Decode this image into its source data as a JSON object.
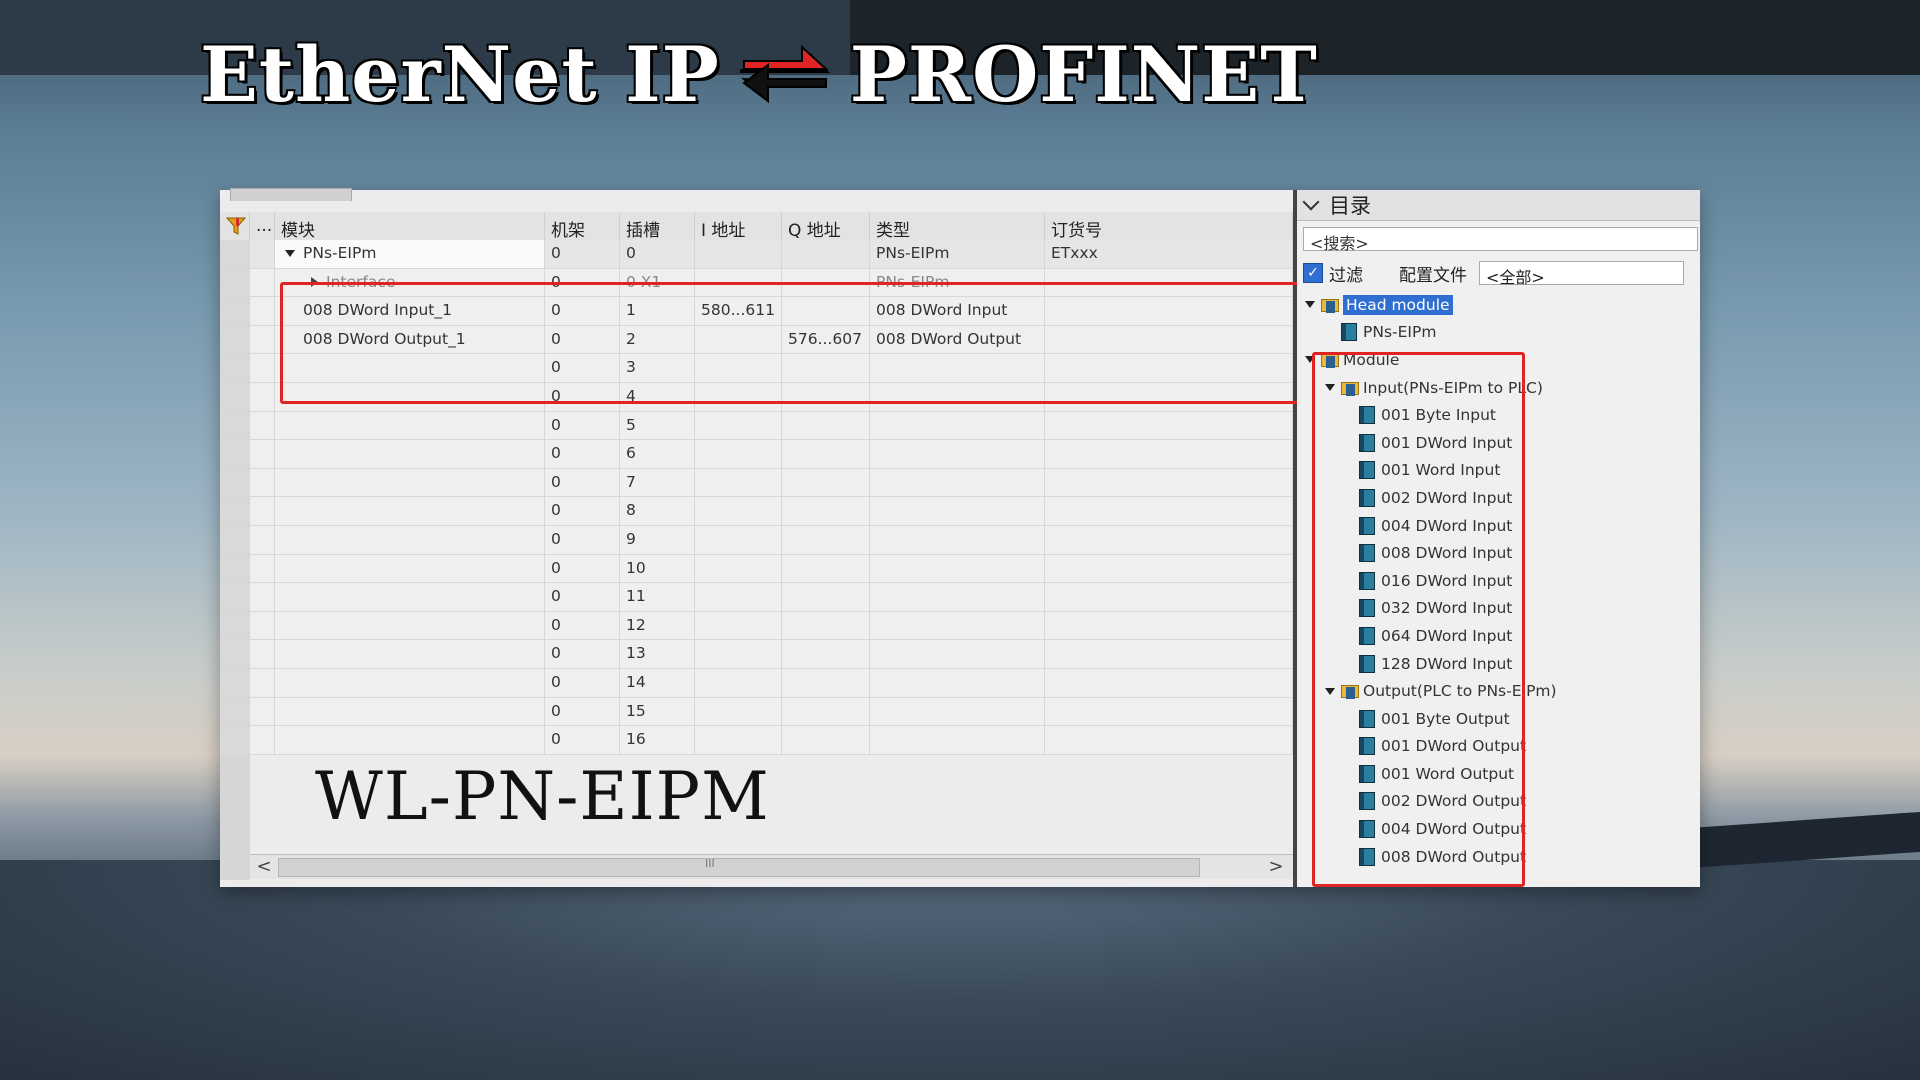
{
  "title": {
    "left": "EtherNet IP",
    "right": "PROFINET",
    "arrow_icon": "bidirectional-arrow-icon",
    "arrow_colors": [
      "#e02424",
      "#111111"
    ]
  },
  "overlay_label": "WL-PN-EIPM",
  "device_view": {
    "columns": [
      "...",
      "模块",
      "机架",
      "插槽",
      "I 地址",
      "Q 地址",
      "类型",
      "订货号"
    ],
    "rows": [
      {
        "name": "PNs-EIPm",
        "rack": "0",
        "slot": "0",
        "i_addr": "",
        "q_addr": "",
        "type": "PNs-EIPm",
        "order": "ETxxx",
        "expander": "open"
      },
      {
        "name": "Interface",
        "rack": "0",
        "slot": "0 X1",
        "i_addr": "",
        "q_addr": "",
        "type": "PNs-EIPm",
        "order": "",
        "expander": "closed"
      },
      {
        "name": "008 DWord Input_1",
        "rack": "0",
        "slot": "1",
        "i_addr": "580...611",
        "q_addr": "",
        "type": "008 DWord Input",
        "order": ""
      },
      {
        "name": "008 DWord Output_1",
        "rack": "0",
        "slot": "2",
        "i_addr": "",
        "q_addr": "576...607",
        "type": "008 DWord Output",
        "order": ""
      },
      {
        "name": "",
        "rack": "0",
        "slot": "3",
        "i_addr": "",
        "q_addr": "",
        "type": "",
        "order": ""
      },
      {
        "name": "",
        "rack": "0",
        "slot": "4",
        "i_addr": "",
        "q_addr": "",
        "type": "",
        "order": ""
      },
      {
        "name": "",
        "rack": "0",
        "slot": "5",
        "i_addr": "",
        "q_addr": "",
        "type": "",
        "order": ""
      },
      {
        "name": "",
        "rack": "0",
        "slot": "6",
        "i_addr": "",
        "q_addr": "",
        "type": "",
        "order": ""
      },
      {
        "name": "",
        "rack": "0",
        "slot": "7",
        "i_addr": "",
        "q_addr": "",
        "type": "",
        "order": ""
      },
      {
        "name": "",
        "rack": "0",
        "slot": "8",
        "i_addr": "",
        "q_addr": "",
        "type": "",
        "order": ""
      },
      {
        "name": "",
        "rack": "0",
        "slot": "9",
        "i_addr": "",
        "q_addr": "",
        "type": "",
        "order": ""
      },
      {
        "name": "",
        "rack": "0",
        "slot": "10",
        "i_addr": "",
        "q_addr": "",
        "type": "",
        "order": ""
      },
      {
        "name": "",
        "rack": "0",
        "slot": "11",
        "i_addr": "",
        "q_addr": "",
        "type": "",
        "order": ""
      },
      {
        "name": "",
        "rack": "0",
        "slot": "12",
        "i_addr": "",
        "q_addr": "",
        "type": "",
        "order": ""
      },
      {
        "name": "",
        "rack": "0",
        "slot": "13",
        "i_addr": "",
        "q_addr": "",
        "type": "",
        "order": ""
      },
      {
        "name": "",
        "rack": "0",
        "slot": "14",
        "i_addr": "",
        "q_addr": "",
        "type": "",
        "order": ""
      },
      {
        "name": "",
        "rack": "0",
        "slot": "15",
        "i_addr": "",
        "q_addr": "",
        "type": "",
        "order": ""
      },
      {
        "name": "",
        "rack": "0",
        "slot": "16",
        "i_addr": "",
        "q_addr": "",
        "type": "",
        "order": ""
      }
    ],
    "scroll_left": "<",
    "scroll_right": ">",
    "scroll_grip": "III"
  },
  "catalog": {
    "header": "目录",
    "search_placeholder": "<搜索>",
    "filter_label": "过滤",
    "profile_label": "配置文件",
    "profile_value": "<全部>",
    "tree": [
      {
        "label": "Head module",
        "level": 0,
        "kind": "folder",
        "open": true,
        "selected": true
      },
      {
        "label": "PNs-EIPm",
        "level": 1,
        "kind": "module"
      },
      {
        "label": "Module",
        "level": 0,
        "kind": "folder",
        "open": true
      },
      {
        "label": "Input(PNs-EIPm to PLC)",
        "level": 1,
        "kind": "folder",
        "open": true
      },
      {
        "label": "001 Byte Input",
        "level": 2,
        "kind": "module"
      },
      {
        "label": "001 DWord Input",
        "level": 2,
        "kind": "module"
      },
      {
        "label": "001 Word Input",
        "level": 2,
        "kind": "module"
      },
      {
        "label": "002 DWord Input",
        "level": 2,
        "kind": "module"
      },
      {
        "label": "004 DWord Input",
        "level": 2,
        "kind": "module"
      },
      {
        "label": "008 DWord Input",
        "level": 2,
        "kind": "module"
      },
      {
        "label": "016 DWord Input",
        "level": 2,
        "kind": "module"
      },
      {
        "label": "032 DWord Input",
        "level": 2,
        "kind": "module"
      },
      {
        "label": "064 DWord Input",
        "level": 2,
        "kind": "module"
      },
      {
        "label": "128 DWord Input",
        "level": 2,
        "kind": "module"
      },
      {
        "label": "Output(PLC to PNs-EIPm)",
        "level": 1,
        "kind": "folder",
        "open": true
      },
      {
        "label": "001 Byte Output",
        "level": 2,
        "kind": "module"
      },
      {
        "label": "001 DWord Output",
        "level": 2,
        "kind": "module"
      },
      {
        "label": "001 Word Output",
        "level": 2,
        "kind": "module"
      },
      {
        "label": "002 DWord Output",
        "level": 2,
        "kind": "module"
      },
      {
        "label": "004 DWord Output",
        "level": 2,
        "kind": "module"
      },
      {
        "label": "008 DWord Output",
        "level": 2,
        "kind": "module"
      }
    ]
  },
  "colors": {
    "highlight_box": "#e02424",
    "selection": "#2f6fd1"
  }
}
